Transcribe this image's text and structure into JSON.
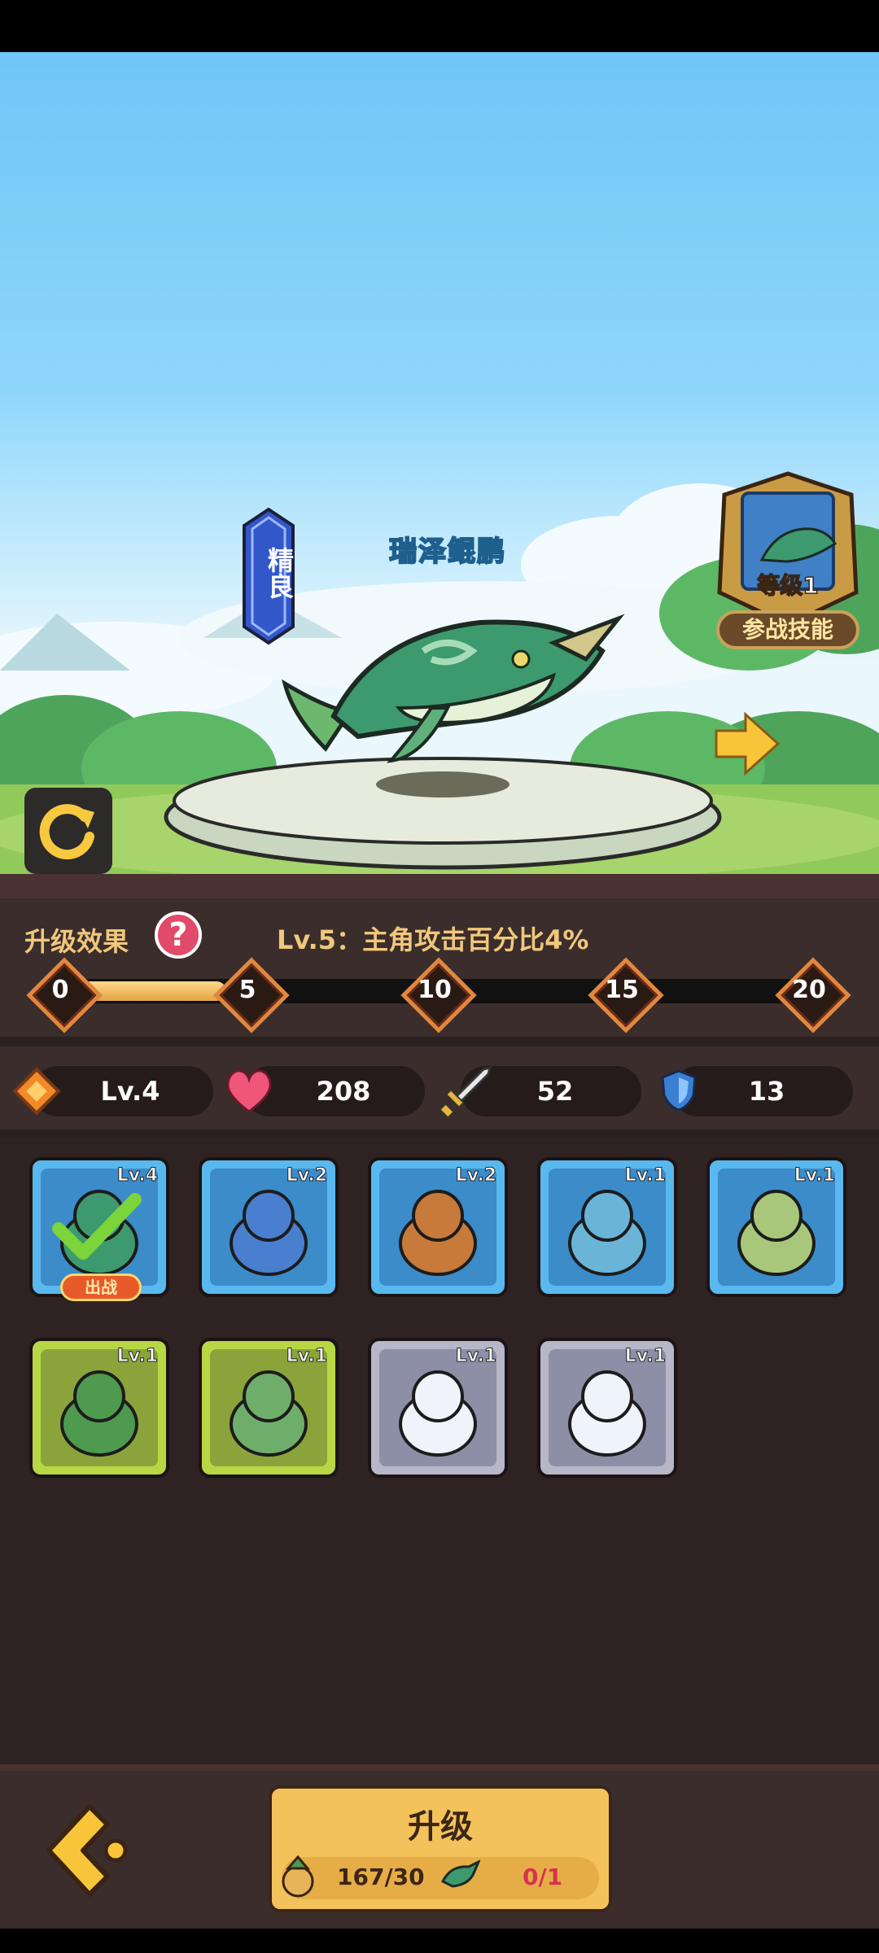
{
  "pet": {
    "name": "瑞泽鲲鹏",
    "quality": "精良"
  },
  "skill": {
    "level_text": "等级1",
    "label": "参战技能"
  },
  "upgrade_effect": {
    "title": "升级效果",
    "help_icon": "?",
    "description": "Lv.5：主角攻击百分比4%",
    "milestones": [
      "0",
      "5",
      "10",
      "15",
      "20"
    ],
    "progress_fraction": 0.2
  },
  "stats": {
    "level": "Lv.4",
    "hp": "208",
    "attack": "52",
    "defense": "13"
  },
  "roster": [
    {
      "level": "Lv.4",
      "frame": "blue",
      "creature": "green-whale",
      "deployed_label": "出战"
    },
    {
      "level": "Lv.2",
      "frame": "blue",
      "creature": "blue-tiger"
    },
    {
      "level": "Lv.2",
      "frame": "blue",
      "creature": "fox-cat"
    },
    {
      "level": "Lv.1",
      "frame": "blue",
      "creature": "sea-dragon"
    },
    {
      "level": "Lv.1",
      "frame": "blue",
      "creature": "jade-beast"
    },
    {
      "level": "Lv.1",
      "frame": "green",
      "creature": "green-fox"
    },
    {
      "level": "Lv.1",
      "frame": "green",
      "creature": "green-unicorn"
    },
    {
      "level": "Lv.1",
      "frame": "grey",
      "creature": "white-tiger"
    },
    {
      "level": "Lv.1",
      "frame": "grey",
      "creature": "white-horse"
    }
  ],
  "bottom": {
    "upgrade_label": "升级",
    "cost1": "167/30",
    "cost2": "0/1"
  },
  "colors": {
    "gold": "#f0c77b",
    "panel": "#3a2d2c",
    "button": "#f3c25a",
    "accent_red": "#d8324f"
  }
}
